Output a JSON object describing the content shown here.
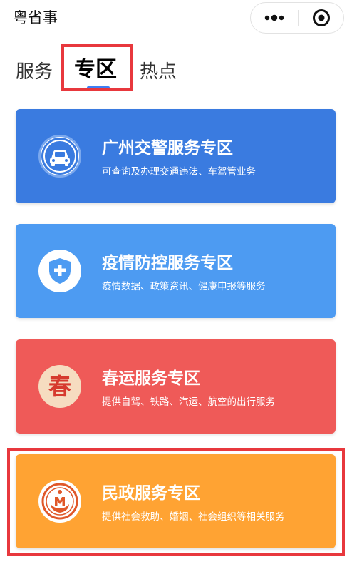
{
  "app": {
    "title": "粤省事"
  },
  "capsule": {
    "more_icon": "more-dots-icon",
    "close_icon": "target-close-icon"
  },
  "tabs": [
    {
      "label": "服务",
      "active": false
    },
    {
      "label": "专区",
      "active": true
    },
    {
      "label": "热点",
      "active": false
    }
  ],
  "colors": {
    "active_tab_underline": "#3d7ff5",
    "highlight_border": "#e8383d"
  },
  "cards": [
    {
      "title": "广州交警服务专区",
      "subtitle": "可查询及办理交通违法、车驾管业务",
      "icon": "car-icon",
      "color": "#3a7be0"
    },
    {
      "title": "疫情防控服务专区",
      "subtitle": "疫情数据、政策资讯、健康申报等服务",
      "icon": "shield-plus-icon",
      "color": "#4d9bf2"
    },
    {
      "title": "春运服务专区",
      "subtitle": "提供自驾、铁路、汽运、航空的出行服务",
      "icon": "spring-icon",
      "icon_text": "春",
      "color": "#ef5a58"
    },
    {
      "title": "民政服务专区",
      "subtitle": "提供社会救助、婚姻、社会组织等相关服务",
      "icon": "civil-affairs-emblem-icon",
      "color": "#ffa333"
    }
  ]
}
